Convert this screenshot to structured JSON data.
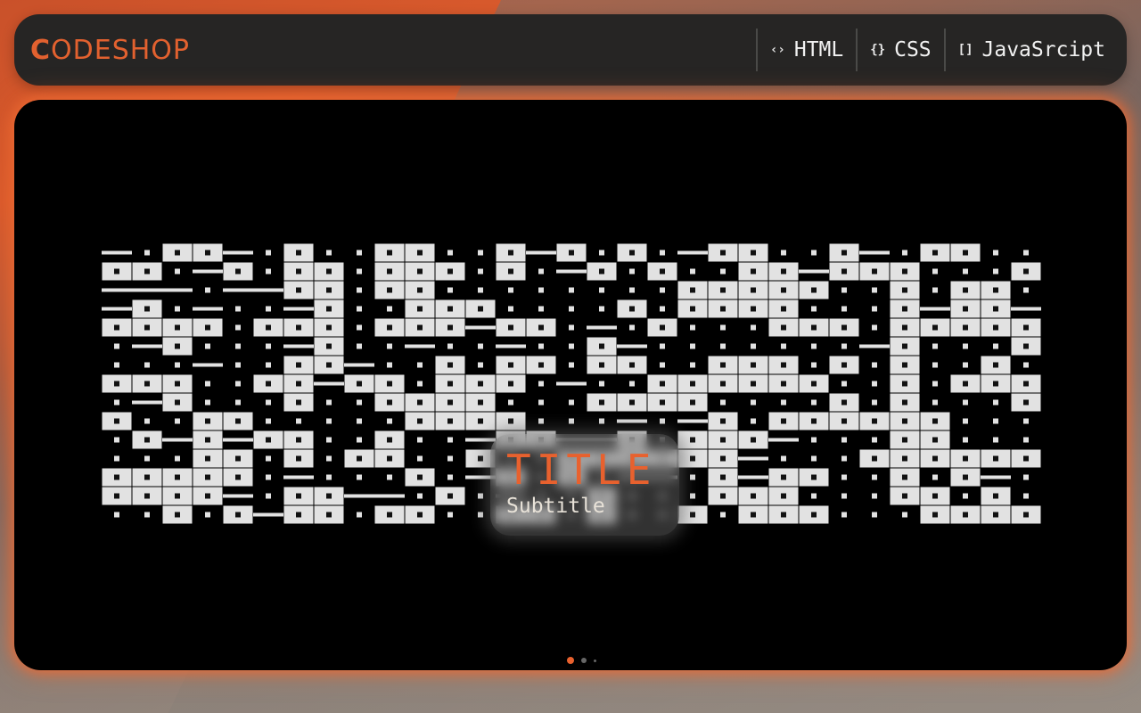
{
  "header": {
    "logo_first": "C",
    "logo_rest": "ODESHOP",
    "nav": [
      {
        "icon": "‹›",
        "label": "HTML"
      },
      {
        "icon": "{}",
        "label": "CSS"
      },
      {
        "icon": "[]",
        "label": "JavaSrcipt"
      }
    ]
  },
  "hero": {
    "title": "TITLE",
    "subtitle": "Subtitle"
  },
  "colors": {
    "accent": "#e8612e",
    "tile": "#e2e2e2",
    "stage_bg": "#000000"
  },
  "slides": {
    "count": 3,
    "active": 1
  }
}
